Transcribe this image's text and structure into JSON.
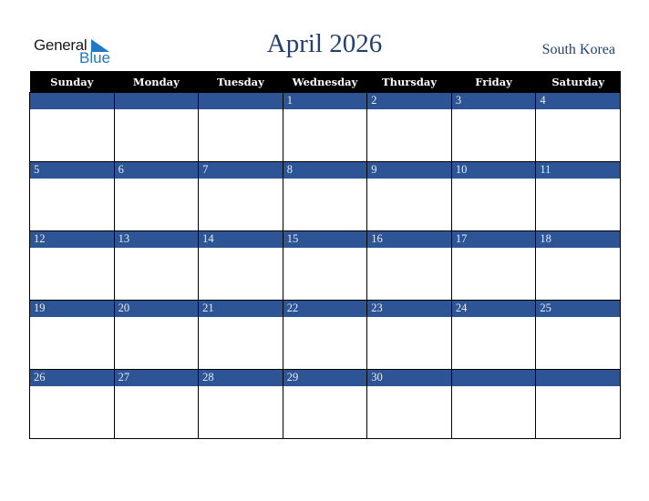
{
  "logo": {
    "line1": "General",
    "line2": "Blue",
    "accent_color": "#1f7ac4"
  },
  "header": {
    "title": "April 2026",
    "country": "South Korea"
  },
  "colors": {
    "header_bg": "#000000",
    "day_bar": "#2d5596",
    "title_text": "#24406e"
  },
  "weekdays": [
    "Sunday",
    "Monday",
    "Tuesday",
    "Wednesday",
    "Thursday",
    "Friday",
    "Saturday"
  ],
  "weeks": [
    [
      "",
      "",
      "",
      "1",
      "2",
      "3",
      "4"
    ],
    [
      "5",
      "6",
      "7",
      "8",
      "9",
      "10",
      "11"
    ],
    [
      "12",
      "13",
      "14",
      "15",
      "16",
      "17",
      "18"
    ],
    [
      "19",
      "20",
      "21",
      "22",
      "23",
      "24",
      "25"
    ],
    [
      "26",
      "27",
      "28",
      "29",
      "30",
      "",
      ""
    ]
  ]
}
